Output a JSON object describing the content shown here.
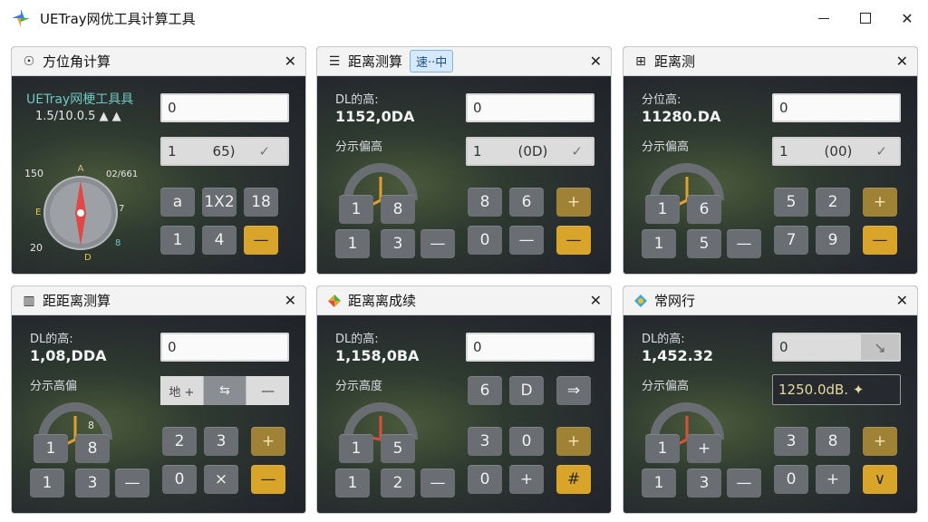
{
  "window": {
    "title": "UETray网优工具计算工具",
    "icon": "app-pinwheel-icon"
  },
  "panels": [
    {
      "title": "方位角计算",
      "icon": "compass-check-icon",
      "brand": "UETray网梗工具具",
      "subline": "1.5/10.0.5 ▲ ▲",
      "dial_labels": {
        "n": "A",
        "w": "150",
        "ne": "02/661",
        "e": "7",
        "sw": "20",
        "s": "D",
        "w2": "E",
        "se": "8"
      },
      "field_top": "0",
      "field_mid_left": "1",
      "field_mid_center": "65)",
      "field_mid_right": "✓",
      "keys_row1": [
        "a",
        "1X2",
        "18"
      ],
      "keys_row2": [
        "1",
        "4",
        "—"
      ]
    },
    {
      "title": "距离测算",
      "icon": "list-icon",
      "tag": "速··中",
      "label1": "DL的高:",
      "value1": "1152,0DA",
      "label2": "分示偏高",
      "field_top": "0",
      "field_mid_left": "1",
      "field_mid_center": "(0D)",
      "field_mid_right": "✓",
      "keys_a": [
        "1",
        "8"
      ],
      "keys_b": [
        "1",
        "3",
        "—"
      ],
      "keys_r1": [
        "8",
        "6",
        "+"
      ],
      "keys_r2": [
        "0",
        "—",
        "—"
      ]
    },
    {
      "title": "距离测",
      "icon": "grid-icon",
      "label1": "分位高:",
      "value1": "11280.DA",
      "label2": "分示偏高",
      "field_top": "0",
      "field_mid_left": "1",
      "field_mid_center": "(00)",
      "field_mid_right": "✓",
      "keys_a": [
        "1",
        "6"
      ],
      "keys_b": [
        "1",
        "5",
        "—"
      ],
      "keys_r1": [
        "5",
        "2",
        "+"
      ],
      "keys_r2": [
        "7",
        "9",
        "—"
      ]
    },
    {
      "title": "距距离测算",
      "icon": "bars-icon",
      "label1": "DL的高:",
      "value1": "1,08,DDA",
      "label2": "分示高偏",
      "dial_num": "8",
      "field_top": "0",
      "seg": [
        "地 +",
        "⇆",
        "—"
      ],
      "keys_a": [
        "1",
        "8"
      ],
      "keys_b": [
        "1",
        "3",
        "—"
      ],
      "keys_r1": [
        "2",
        "3",
        "+"
      ],
      "keys_r2": [
        "0",
        "×",
        "—"
      ]
    },
    {
      "title": "距离离成续",
      "icon": "diamond-icon",
      "label1": "DL的高:",
      "value1": "1,158,0BA",
      "label2": "分示高度",
      "field_top": "0",
      "keys_a": [
        "1",
        "5"
      ],
      "keys_b": [
        "1",
        "2",
        "—"
      ],
      "keys_r0": [
        "6",
        "D",
        "⇒"
      ],
      "keys_r1": [
        "3",
        "0",
        "+"
      ],
      "keys_r2": [
        "0",
        "+",
        "#"
      ]
    },
    {
      "title": "常网行",
      "icon": "target-icon",
      "label1": "DL的高:",
      "value1": "1,452.32",
      "label2": "分示偏高",
      "field_top": "0",
      "field_top_icon": "↘",
      "field_result": "1250.0dB. ✦",
      "keys_a": [
        "1",
        "+"
      ],
      "keys_b": [
        "1",
        "3",
        "—"
      ],
      "keys_r1": [
        "3",
        "8",
        "+"
      ],
      "keys_r2": [
        "0",
        "+",
        "∨"
      ]
    }
  ]
}
